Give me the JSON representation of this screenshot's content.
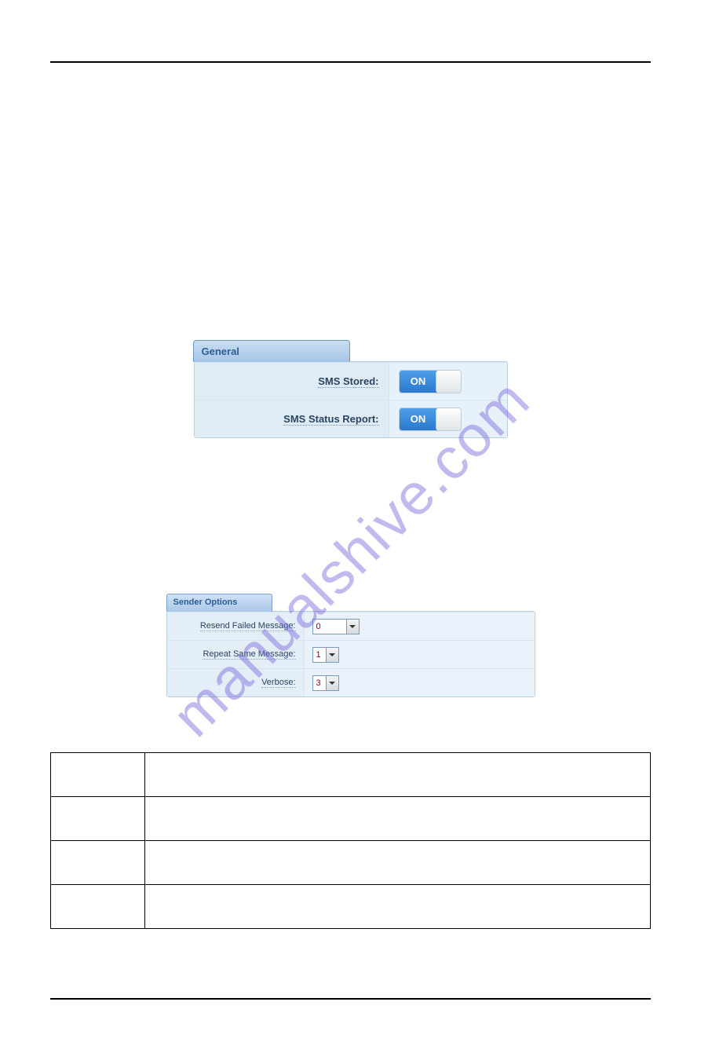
{
  "watermark": "manualshive.com",
  "general_panel": {
    "tab_label": "General",
    "rows": [
      {
        "label": "SMS Stored:",
        "toggle": "ON"
      },
      {
        "label": "SMS Status Report:",
        "toggle": "ON"
      }
    ]
  },
  "sender_panel": {
    "tab_label": "Sender Options",
    "rows": [
      {
        "label": "Resend Failed Message:",
        "value": "0"
      },
      {
        "label": "Repeat Same Message:",
        "value": "1"
      },
      {
        "label": "Verbose:",
        "value": "3"
      }
    ]
  }
}
